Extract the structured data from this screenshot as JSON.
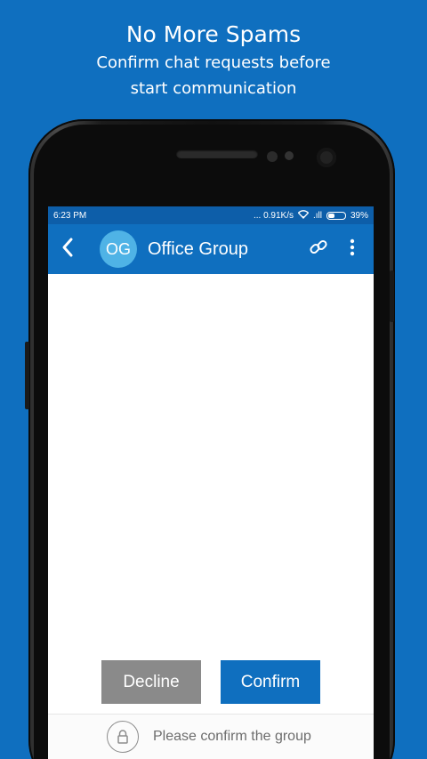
{
  "promo": {
    "headline": "No More Spams",
    "sub_line1": "Confirm chat requests before",
    "sub_line2": "start communication"
  },
  "statusbar": {
    "time": "6:23 PM",
    "speed": "... 0.91K/s",
    "signal": ".ıll",
    "battery": "39%"
  },
  "appbar": {
    "avatar_initials": "OG",
    "title": "Office Group"
  },
  "actions": {
    "decline_label": "Decline",
    "confirm_label": "Confirm"
  },
  "footer": {
    "text": "Please confirm the group"
  },
  "colors": {
    "background": "#0f6fbf",
    "accent": "#0f6fbf",
    "statusbar": "#0d5ea9",
    "avatar": "#4fb3e6",
    "decline": "#8a8a8a"
  }
}
